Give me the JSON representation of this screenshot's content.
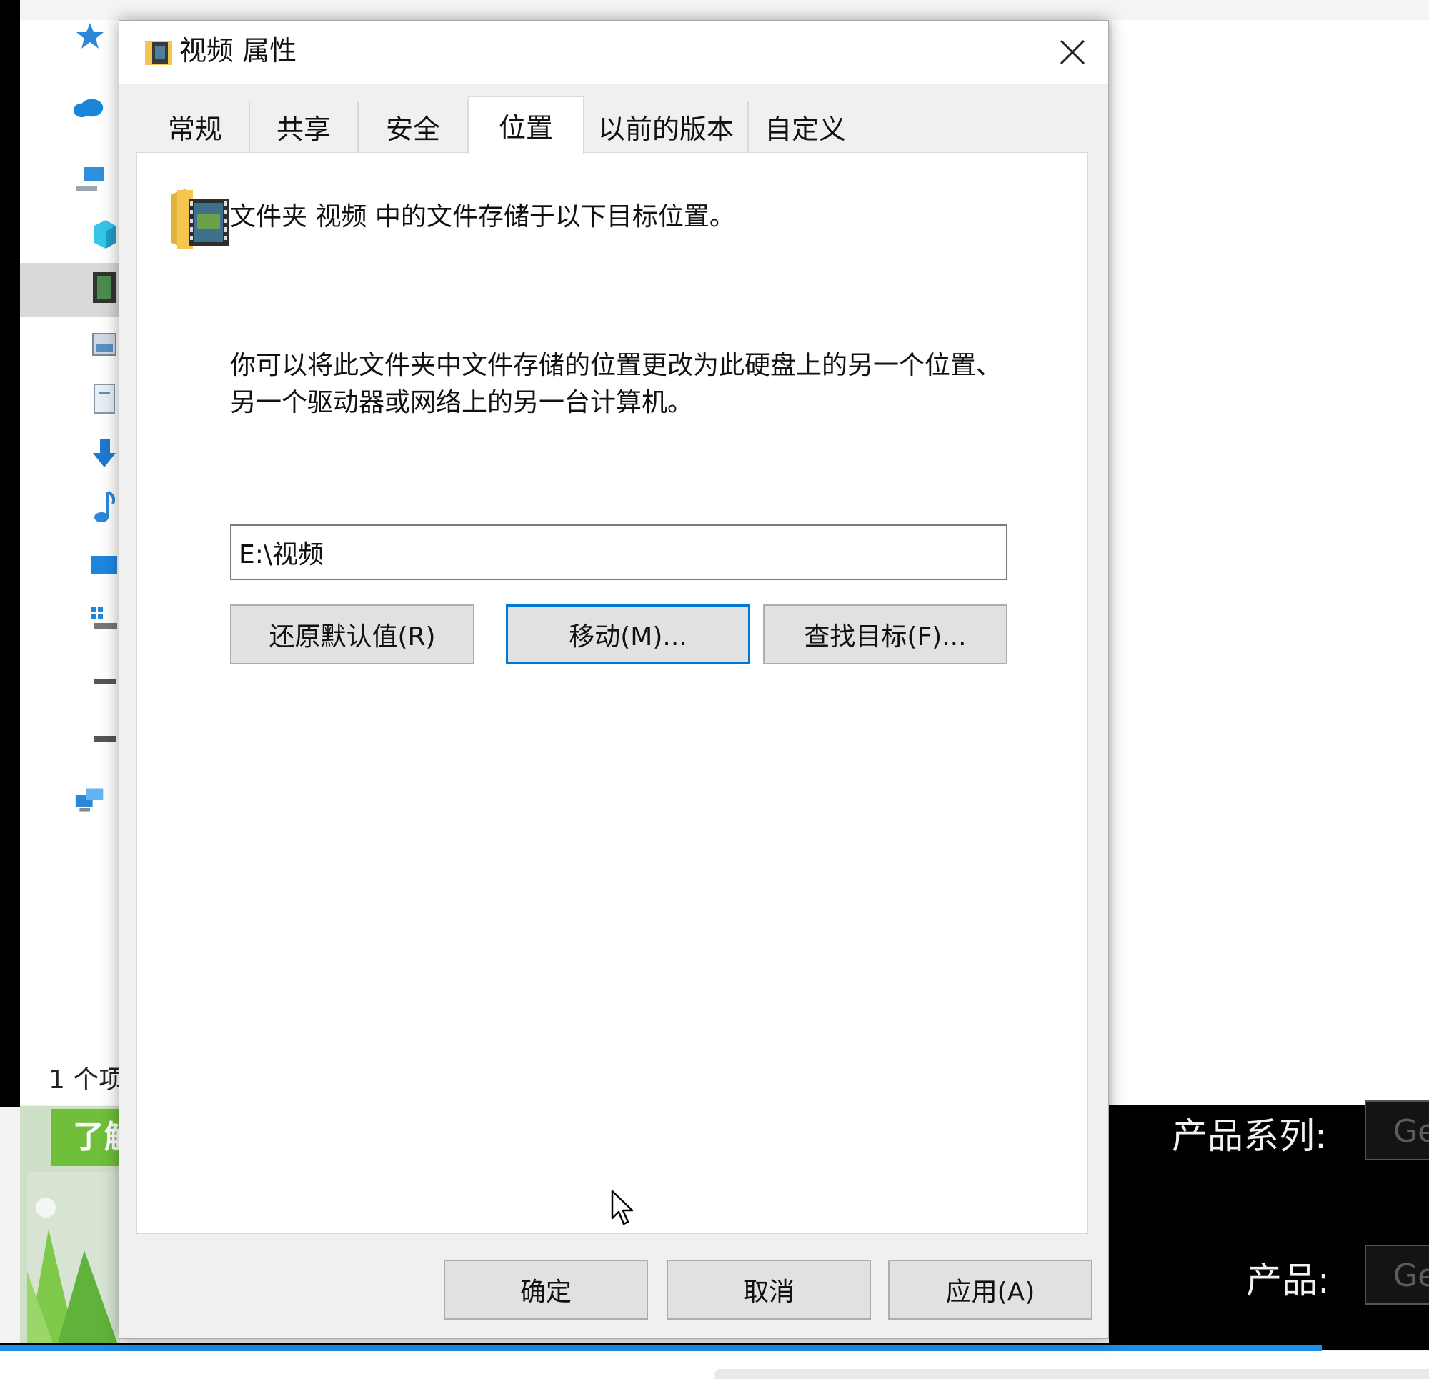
{
  "dialog": {
    "title": "视频 属性",
    "tabs": [
      {
        "label": "常规",
        "active": false
      },
      {
        "label": "共享",
        "active": false
      },
      {
        "label": "安全",
        "active": false
      },
      {
        "label": "位置",
        "active": true
      },
      {
        "label": "以前的版本",
        "active": false
      },
      {
        "label": "自定义",
        "active": false
      }
    ],
    "location": {
      "header": "文件夹 视频 中的文件存储于以下目标位置。",
      "description": "你可以将此文件夹中文件存储的位置更改为此硬盘上的另一个位置、另一个驱动器或网络上的另一台计算机。",
      "path_value": "E:\\视频",
      "restore_button": "还原默认值(R)",
      "move_button": "移动(M)...",
      "find_target_button": "查找目标(F)..."
    },
    "footer": {
      "ok_button": "确定",
      "cancel_button": "取消",
      "apply_button": "应用(A)"
    }
  },
  "background": {
    "explorer_status": "1 个项",
    "web_button": "了解",
    "product_series_label": "产品系列:",
    "product_series_value": "Ge",
    "product_label": "产品:",
    "product_value": "Ge"
  },
  "colors": {
    "accent_blue": "#0078d7",
    "folder_yellow": "#f4c64e",
    "web_green": "#6fbf3a"
  }
}
